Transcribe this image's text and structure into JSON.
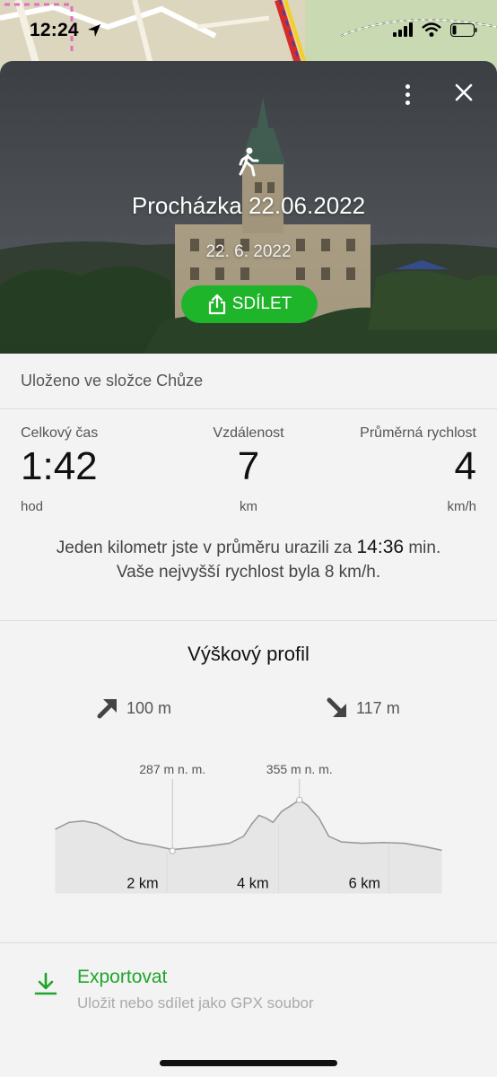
{
  "status_bar": {
    "time": "12:24"
  },
  "hero": {
    "title": "Procházka 22.06.2022",
    "date": "22. 6. 2022",
    "share_label": "SDÍLET"
  },
  "folder": {
    "text": "Uloženo ve složce Chůze"
  },
  "stats": {
    "total_time": {
      "label": "Celkový čas",
      "value": "1:42",
      "unit": "hod"
    },
    "distance": {
      "label": "Vzdálenost",
      "value": "7",
      "unit": "km"
    },
    "avg_speed": {
      "label": "Průměrná rychlost",
      "value": "4",
      "unit": "km/h"
    }
  },
  "summary": {
    "line1_prefix": "Jeden kilometr jste v průměru urazili za",
    "line1_value": "14:36",
    "line1_suffix": "min.",
    "line2": "Vaše nejvyšší rychlost byla 8 km/h."
  },
  "profile": {
    "title": "Výškový profil",
    "ascent": "100 m",
    "descent": "117 m",
    "min_label": "287 m n. m.",
    "max_label": "355 m n. m.",
    "x_ticks": [
      "2 km",
      "4 km",
      "6 km"
    ]
  },
  "export": {
    "title": "Exportovat",
    "subtitle": "Uložit nebo sdílet jako GPX soubor"
  },
  "colors": {
    "accent": "#1fb52a"
  }
}
